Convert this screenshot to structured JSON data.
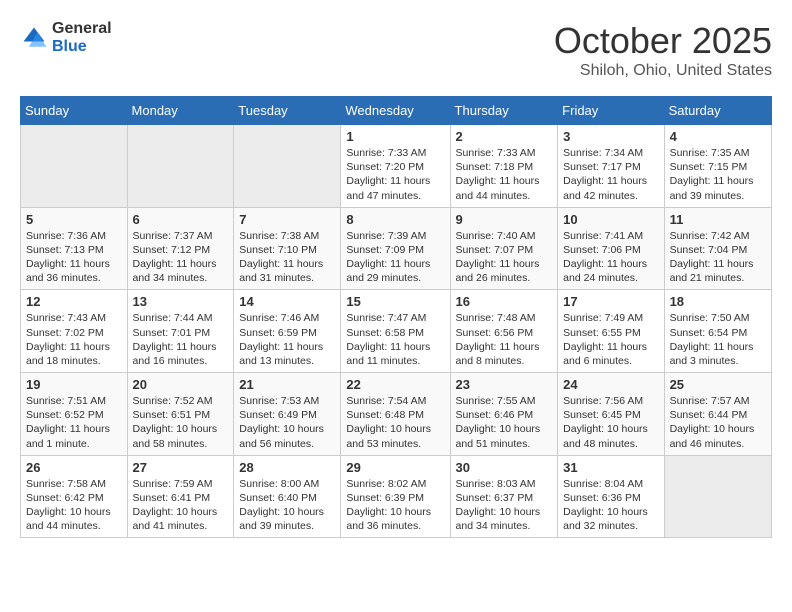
{
  "header": {
    "logo_general": "General",
    "logo_blue": "Blue",
    "month": "October 2025",
    "location": "Shiloh, Ohio, United States"
  },
  "days_of_week": [
    "Sunday",
    "Monday",
    "Tuesday",
    "Wednesday",
    "Thursday",
    "Friday",
    "Saturday"
  ],
  "weeks": [
    [
      {
        "day": "",
        "info": ""
      },
      {
        "day": "",
        "info": ""
      },
      {
        "day": "",
        "info": ""
      },
      {
        "day": "1",
        "info": "Sunrise: 7:33 AM\nSunset: 7:20 PM\nDaylight: 11 hours\nand 47 minutes."
      },
      {
        "day": "2",
        "info": "Sunrise: 7:33 AM\nSunset: 7:18 PM\nDaylight: 11 hours\nand 44 minutes."
      },
      {
        "day": "3",
        "info": "Sunrise: 7:34 AM\nSunset: 7:17 PM\nDaylight: 11 hours\nand 42 minutes."
      },
      {
        "day": "4",
        "info": "Sunrise: 7:35 AM\nSunset: 7:15 PM\nDaylight: 11 hours\nand 39 minutes."
      }
    ],
    [
      {
        "day": "5",
        "info": "Sunrise: 7:36 AM\nSunset: 7:13 PM\nDaylight: 11 hours\nand 36 minutes."
      },
      {
        "day": "6",
        "info": "Sunrise: 7:37 AM\nSunset: 7:12 PM\nDaylight: 11 hours\nand 34 minutes."
      },
      {
        "day": "7",
        "info": "Sunrise: 7:38 AM\nSunset: 7:10 PM\nDaylight: 11 hours\nand 31 minutes."
      },
      {
        "day": "8",
        "info": "Sunrise: 7:39 AM\nSunset: 7:09 PM\nDaylight: 11 hours\nand 29 minutes."
      },
      {
        "day": "9",
        "info": "Sunrise: 7:40 AM\nSunset: 7:07 PM\nDaylight: 11 hours\nand 26 minutes."
      },
      {
        "day": "10",
        "info": "Sunrise: 7:41 AM\nSunset: 7:06 PM\nDaylight: 11 hours\nand 24 minutes."
      },
      {
        "day": "11",
        "info": "Sunrise: 7:42 AM\nSunset: 7:04 PM\nDaylight: 11 hours\nand 21 minutes."
      }
    ],
    [
      {
        "day": "12",
        "info": "Sunrise: 7:43 AM\nSunset: 7:02 PM\nDaylight: 11 hours\nand 18 minutes."
      },
      {
        "day": "13",
        "info": "Sunrise: 7:44 AM\nSunset: 7:01 PM\nDaylight: 11 hours\nand 16 minutes."
      },
      {
        "day": "14",
        "info": "Sunrise: 7:46 AM\nSunset: 6:59 PM\nDaylight: 11 hours\nand 13 minutes."
      },
      {
        "day": "15",
        "info": "Sunrise: 7:47 AM\nSunset: 6:58 PM\nDaylight: 11 hours\nand 11 minutes."
      },
      {
        "day": "16",
        "info": "Sunrise: 7:48 AM\nSunset: 6:56 PM\nDaylight: 11 hours\nand 8 minutes."
      },
      {
        "day": "17",
        "info": "Sunrise: 7:49 AM\nSunset: 6:55 PM\nDaylight: 11 hours\nand 6 minutes."
      },
      {
        "day": "18",
        "info": "Sunrise: 7:50 AM\nSunset: 6:54 PM\nDaylight: 11 hours\nand 3 minutes."
      }
    ],
    [
      {
        "day": "19",
        "info": "Sunrise: 7:51 AM\nSunset: 6:52 PM\nDaylight: 11 hours\nand 1 minute."
      },
      {
        "day": "20",
        "info": "Sunrise: 7:52 AM\nSunset: 6:51 PM\nDaylight: 10 hours\nand 58 minutes."
      },
      {
        "day": "21",
        "info": "Sunrise: 7:53 AM\nSunset: 6:49 PM\nDaylight: 10 hours\nand 56 minutes."
      },
      {
        "day": "22",
        "info": "Sunrise: 7:54 AM\nSunset: 6:48 PM\nDaylight: 10 hours\nand 53 minutes."
      },
      {
        "day": "23",
        "info": "Sunrise: 7:55 AM\nSunset: 6:46 PM\nDaylight: 10 hours\nand 51 minutes."
      },
      {
        "day": "24",
        "info": "Sunrise: 7:56 AM\nSunset: 6:45 PM\nDaylight: 10 hours\nand 48 minutes."
      },
      {
        "day": "25",
        "info": "Sunrise: 7:57 AM\nSunset: 6:44 PM\nDaylight: 10 hours\nand 46 minutes."
      }
    ],
    [
      {
        "day": "26",
        "info": "Sunrise: 7:58 AM\nSunset: 6:42 PM\nDaylight: 10 hours\nand 44 minutes."
      },
      {
        "day": "27",
        "info": "Sunrise: 7:59 AM\nSunset: 6:41 PM\nDaylight: 10 hours\nand 41 minutes."
      },
      {
        "day": "28",
        "info": "Sunrise: 8:00 AM\nSunset: 6:40 PM\nDaylight: 10 hours\nand 39 minutes."
      },
      {
        "day": "29",
        "info": "Sunrise: 8:02 AM\nSunset: 6:39 PM\nDaylight: 10 hours\nand 36 minutes."
      },
      {
        "day": "30",
        "info": "Sunrise: 8:03 AM\nSunset: 6:37 PM\nDaylight: 10 hours\nand 34 minutes."
      },
      {
        "day": "31",
        "info": "Sunrise: 8:04 AM\nSunset: 6:36 PM\nDaylight: 10 hours\nand 32 minutes."
      },
      {
        "day": "",
        "info": ""
      }
    ]
  ]
}
